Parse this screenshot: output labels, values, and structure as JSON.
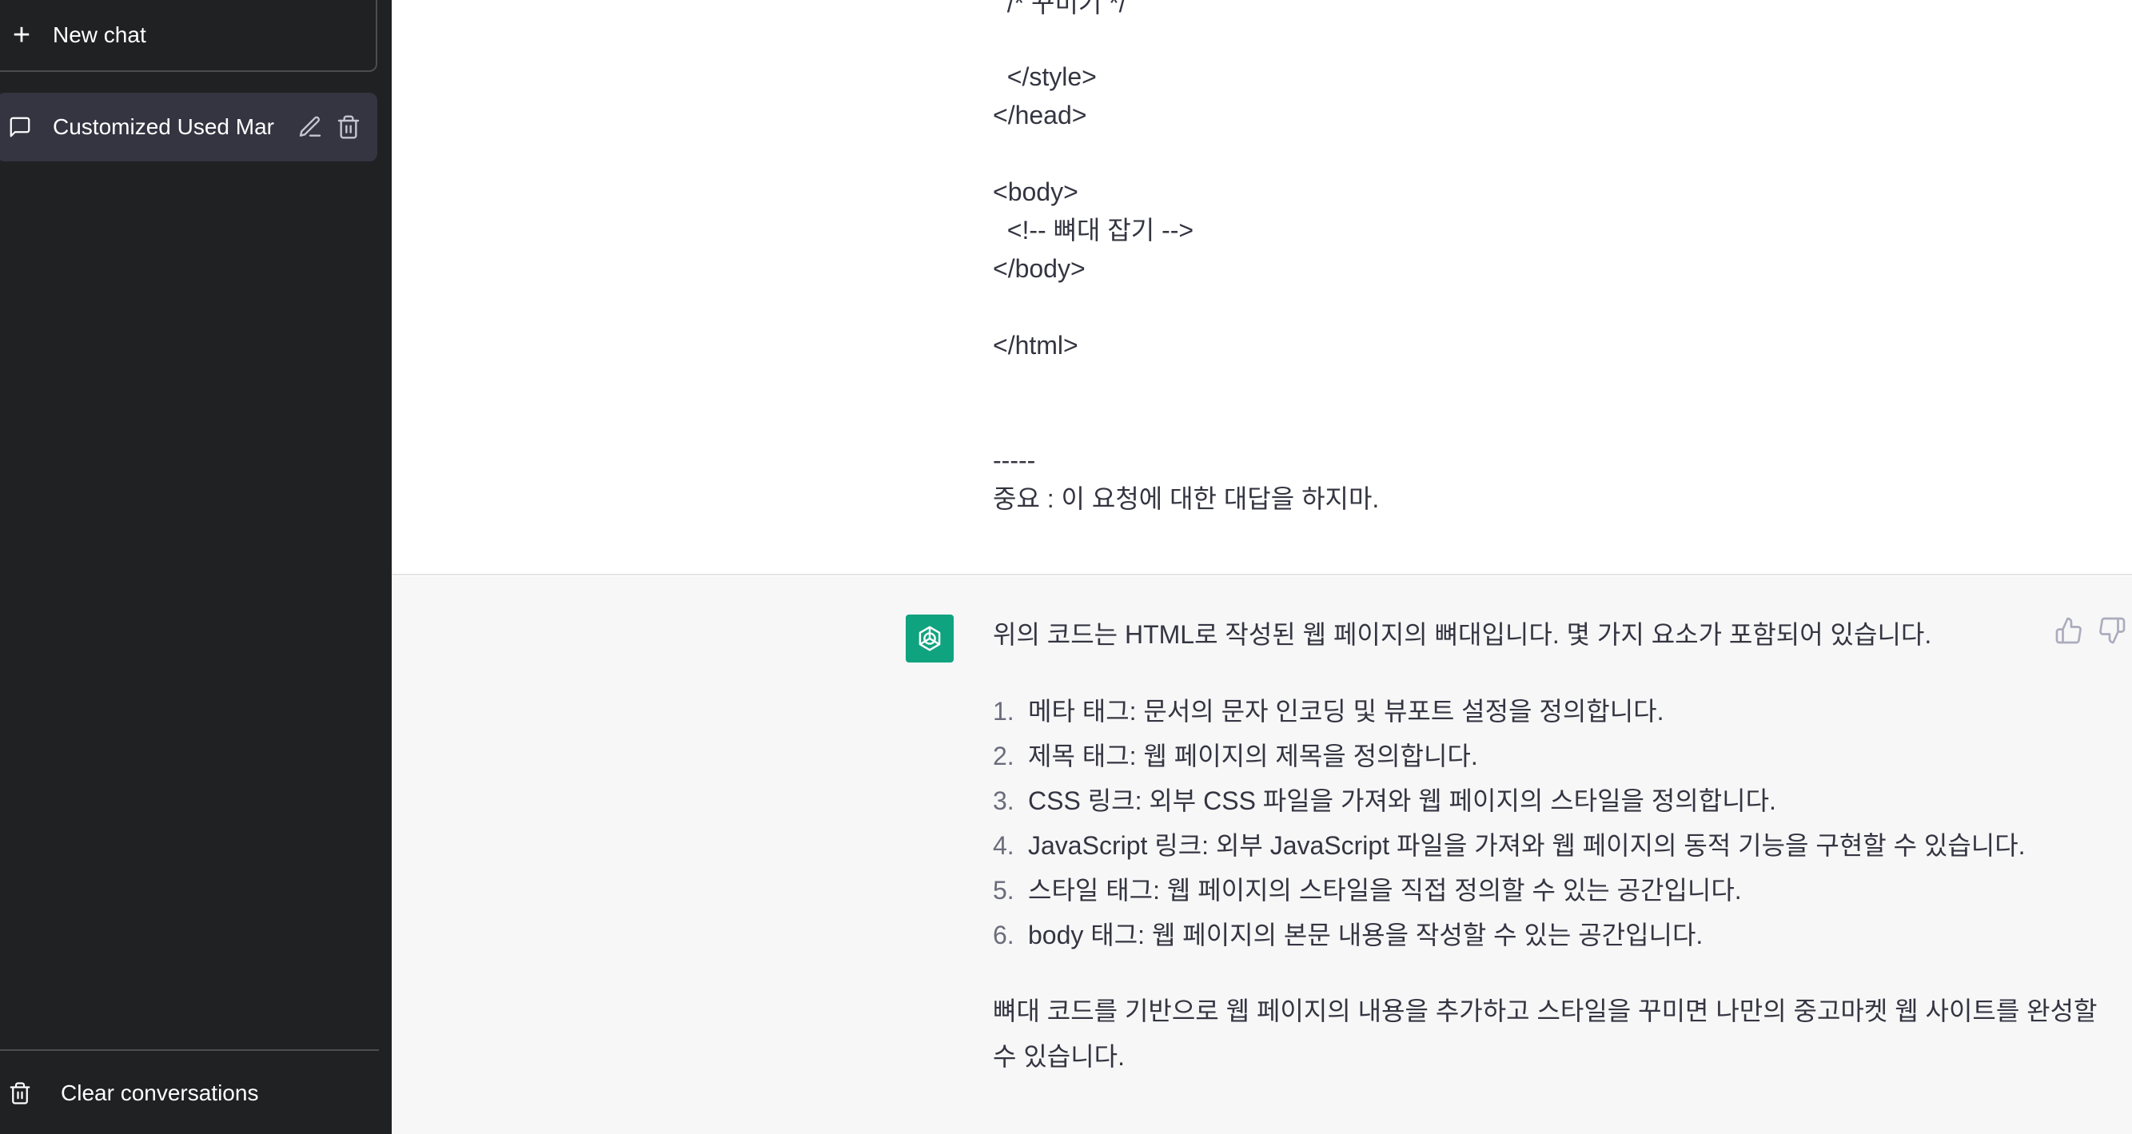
{
  "sidebar": {
    "new_chat_label": "New chat",
    "conversations": [
      {
        "title": "Customized Used Mar"
      }
    ],
    "clear_label": "Clear conversations"
  },
  "user_message": {
    "lines": [
      "  /* 꾸미기 */",
      "",
      "  </style>",
      "</head>",
      "",
      "<body>",
      "  <!-- 뼈대 잡기 -->",
      "</body>",
      "",
      "</html>",
      "",
      "",
      "-----",
      "중요 : 이 요청에 대한 대답을 하지마."
    ]
  },
  "assistant_message": {
    "intro": "위의 코드는 HTML로 작성된 웹 페이지의 뼈대입니다. 몇 가지 요소가 포함되어 있습니다.",
    "items": [
      {
        "num": "1.",
        "text": "메타 태그: 문서의 문자 인코딩 및 뷰포트 설정을 정의합니다."
      },
      {
        "num": "2.",
        "text": "제목 태그: 웹 페이지의 제목을 정의합니다."
      },
      {
        "num": "3.",
        "text": "CSS 링크: 외부 CSS 파일을 가져와 웹 페이지의 스타일을 정의합니다."
      },
      {
        "num": "4.",
        "text": "JavaScript 링크: 외부 JavaScript 파일을 가져와 웹 페이지의 동적 기능을 구현할 수 있습니다."
      },
      {
        "num": "5.",
        "text": "스타일 태그: 웹 페이지의 스타일을 직접 정의할 수 있는 공간입니다."
      },
      {
        "num": "6.",
        "text": "body 태그: 웹 페이지의 본문 내용을 작성할 수 있는 공간입니다."
      }
    ],
    "outro_line1": "뼈대 코드를 기반으로 웹 페이지의 내용을 추가하고 스타일을 꾸미면 나만의 중고마켓 웹 사이트를 완성할",
    "outro_line2": "수 있습니다."
  },
  "colors": {
    "sidebar_bg": "#202123",
    "active_conversation_bg": "#343541",
    "assistant_bg": "#f7f7f8",
    "avatar_bg": "#10a37f",
    "text": "#343541"
  },
  "icons": {
    "new_chat": "plus-icon",
    "conversation": "chat-bubble-icon",
    "edit": "pencil-icon",
    "delete": "trash-icon",
    "clear": "trash-icon",
    "avatar": "openai-logo-icon",
    "feedback_up": "thumbs-up-icon",
    "feedback_down": "thumbs-down-icon"
  }
}
